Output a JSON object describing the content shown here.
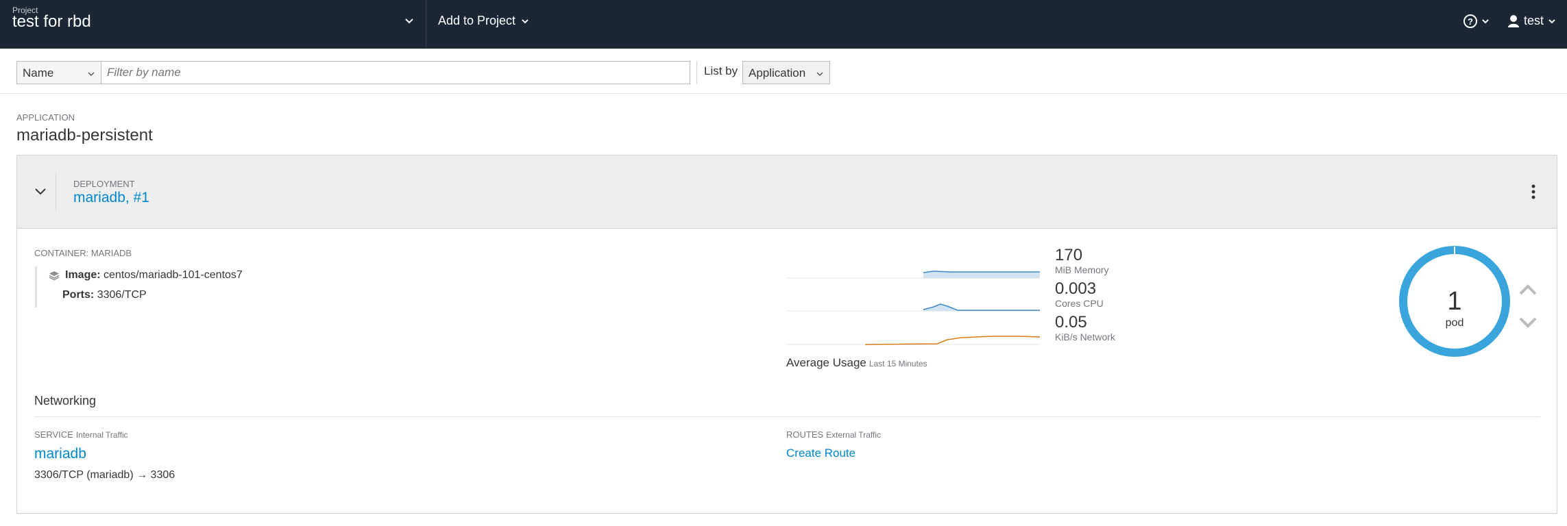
{
  "header": {
    "project_label": "Project",
    "project_name": "test for rbd",
    "add_to_project": "Add to Project",
    "user_name": "test"
  },
  "filter": {
    "field_select": "Name",
    "search_placeholder": "Filter by name",
    "list_by_label": "List by",
    "list_by_value": "Application"
  },
  "application": {
    "label": "APPLICATION",
    "name": "mariadb-persistent"
  },
  "deployment": {
    "label": "DEPLOYMENT",
    "name": "mariadb, #1",
    "container_label": "CONTAINER: MARIADB",
    "image_label": "Image:",
    "image_value": "centos/mariadb-101-centos7",
    "ports_label": "Ports:",
    "ports_value": "3306/TCP"
  },
  "metrics": {
    "memory": {
      "value": "170",
      "unit": "MiB Memory"
    },
    "cpu": {
      "value": "0.003",
      "unit": "Cores CPU"
    },
    "network": {
      "value": "0.05",
      "unit": "KiB/s Network"
    },
    "average_label": "Average Usage",
    "average_period": "Last 15 Minutes",
    "colors": {
      "memory": "#3f88c5",
      "cpu": "#3f88c5",
      "network": "#d97a18"
    }
  },
  "pods": {
    "count": "1",
    "label": "pod",
    "ring_color": "#39a5dc"
  },
  "networking": {
    "title": "Networking",
    "service_label": "SERVICE",
    "service_sublabel": "Internal Traffic",
    "service_name": "mariadb",
    "service_port": "3306/TCP (mariadb) → 3306",
    "routes_label": "ROUTES",
    "routes_sublabel": "External Traffic",
    "create_route": "Create Route"
  },
  "icons": [
    "chevron-down-icon",
    "help-icon",
    "user-icon",
    "layers-icon",
    "kebab-icon",
    "scale-up-icon",
    "scale-down-icon"
  ]
}
